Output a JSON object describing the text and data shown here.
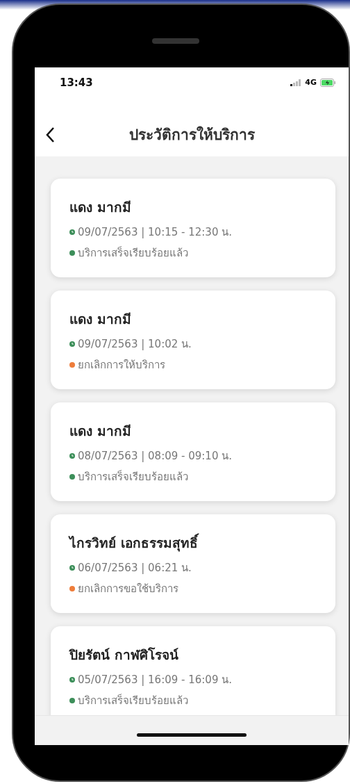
{
  "status_bar": {
    "time": "13:43",
    "network": "4G"
  },
  "header": {
    "title": "ประวัติการให้บริการ"
  },
  "history": [
    {
      "name": "แดง มากมี",
      "datetime": "09/07/2563 | 10:15 - 12:30 น.",
      "status": "บริการเสร็จเรียบร้อยแล้ว",
      "color": "#3d8f5a"
    },
    {
      "name": "แดง มากมี",
      "datetime": "09/07/2563 | 10:02  น.",
      "status": "ยกเลิกการให้บริการ",
      "color": "#ee7d3b"
    },
    {
      "name": "แดง มากมี",
      "datetime": "08/07/2563 | 08:09 - 09:10 น.",
      "status": "บริการเสร็จเรียบร้อยแล้ว",
      "color": "#3d8f5a"
    },
    {
      "name": "ไกรวิทย์ เอกธรรมสุทธิ์",
      "datetime": "06/07/2563 | 06:21  น.",
      "status": "ยกเลิกการขอใช้บริการ",
      "color": "#ee7d3b"
    },
    {
      "name": "ปิยรัตน์ กาฬศิโรจน์",
      "datetime": "05/07/2563 | 16:09 - 16:09 น.",
      "status": "บริการเสร็จเรียบร้อยแล้ว",
      "color": "#3d8f5a"
    }
  ]
}
